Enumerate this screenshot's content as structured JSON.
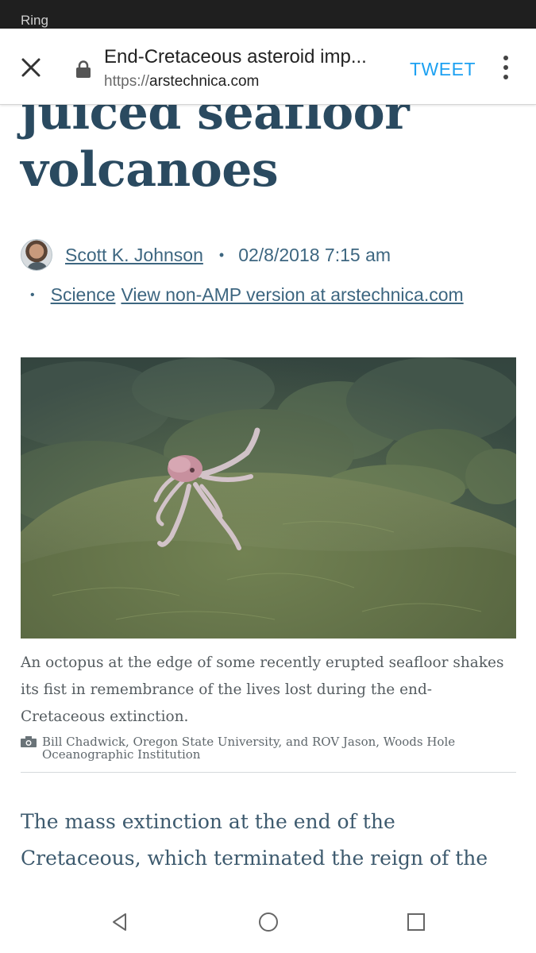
{
  "status_bar": {
    "carrier": "Ring"
  },
  "toolbar": {
    "page_title": "End-Cretaceous asteroid imp...",
    "url_scheme": "https://",
    "url_domain": "arstechnica.com",
    "tweet_label": "TWEET",
    "close_icon": "close-icon",
    "lock_icon": "lock-icon",
    "menu_icon": "more-vert-icon"
  },
  "article": {
    "headline_lines": [
      "juiced seafloor",
      "volcanoes"
    ],
    "author": "Scott K. Johnson",
    "separator": "•",
    "date": "02/8/2018 7:15 am",
    "category_bullet": "•",
    "category": "Science",
    "non_amp_link": "View non-AMP version at arstechnica.com",
    "image_alt": "octopus on seafloor",
    "caption": "An octopus at the edge of some recently erupted seafloor shakes its fist in remembrance of the lives lost during the end-Cretaceous extinction.",
    "credit": "Bill Chadwick, Oregon State University, and ROV Jason, Woods Hole Oceanographic Institution",
    "body_lines": [
      "The mass extinction at the end of the",
      "Cretaceous, which terminated the reign of the"
    ]
  },
  "nav": {
    "back_icon": "back-triangle-icon",
    "home_icon": "home-circle-icon",
    "recents_icon": "recents-square-icon"
  },
  "colors": {
    "headline": "#2a4a60",
    "link": "#3d6680",
    "tweet": "#1da1f2",
    "status_bar": "#1f1f1f"
  }
}
